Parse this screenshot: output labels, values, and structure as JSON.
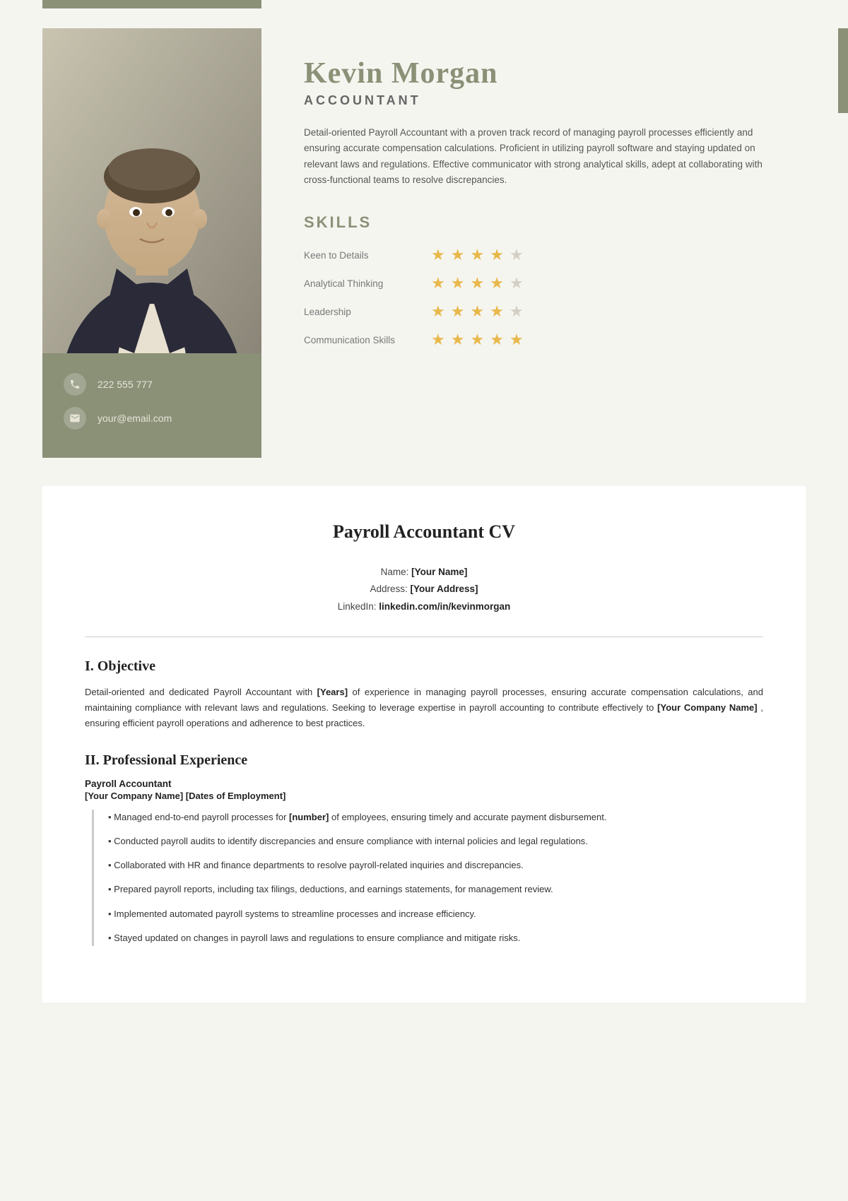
{
  "card": {
    "top_bar_exists": true,
    "name": "Kevin Morgan",
    "job_title": "ACCOUNTANT",
    "bio": "Detail-oriented Payroll Accountant with a proven track record of managing payroll processes efficiently and ensuring accurate compensation calculations. Proficient in utilizing payroll software and staying updated on relevant laws and regulations. Effective communicator with strong analytical skills, adept at collaborating with cross-functional teams to resolve discrepancies.",
    "skills_heading": "SKILLS",
    "skills": [
      {
        "name": "Keen to Details",
        "filled": 4,
        "empty": 1
      },
      {
        "name": "Analytical Thinking",
        "filled": 4,
        "empty": 1
      },
      {
        "name": "Leadership",
        "filled": 4,
        "empty": 1
      },
      {
        "name": "Communication Skills",
        "filled": 5,
        "empty": 0
      }
    ],
    "phone": "222 555 777",
    "email": "your@email.com"
  },
  "cv": {
    "title": "Payroll Accountant CV",
    "name_label": "Name:",
    "name_value": "[Your Name]",
    "address_label": "Address:",
    "address_value": "[Your Address]",
    "linkedin_label": "LinkedIn:",
    "linkedin_value": "linkedin.com/in/kevinmorgan",
    "objective_title": "I. Objective",
    "objective_text_1": "Detail-oriented and dedicated Payroll Accountant with",
    "objective_bold_1": "[Years]",
    "objective_text_2": "of experience in managing payroll processes, ensuring accurate compensation calculations, and maintaining compliance with relevant laws and regulations. Seeking to leverage expertise in payroll accounting to contribute effectively to",
    "objective_bold_2": "[Your Company Name]",
    "objective_text_3": ", ensuring efficient payroll operations and adherence to best practices.",
    "experience_title": "II. Professional Experience",
    "job_title_text": "Payroll Accountant",
    "job_company_text": "[Your Company Name] [Dates of Employment]",
    "bullets": [
      "• Managed end-to-end payroll processes for [number] of employees, ensuring timely and accurate payment disbursement.",
      "• Conducted payroll audits to identify discrepancies and ensure compliance with internal policies and legal regulations.",
      "• Collaborated with HR and finance departments to resolve payroll-related inquiries and discrepancies.",
      "• Prepared payroll reports, including tax filings, deductions, and earnings statements, for management review.",
      "• Implemented automated payroll systems to streamline processes and increase efficiency.",
      "• Stayed updated on changes in payroll laws and regulations to ensure compliance and mitigate risks."
    ],
    "bullet_bold_1": "[number]"
  }
}
